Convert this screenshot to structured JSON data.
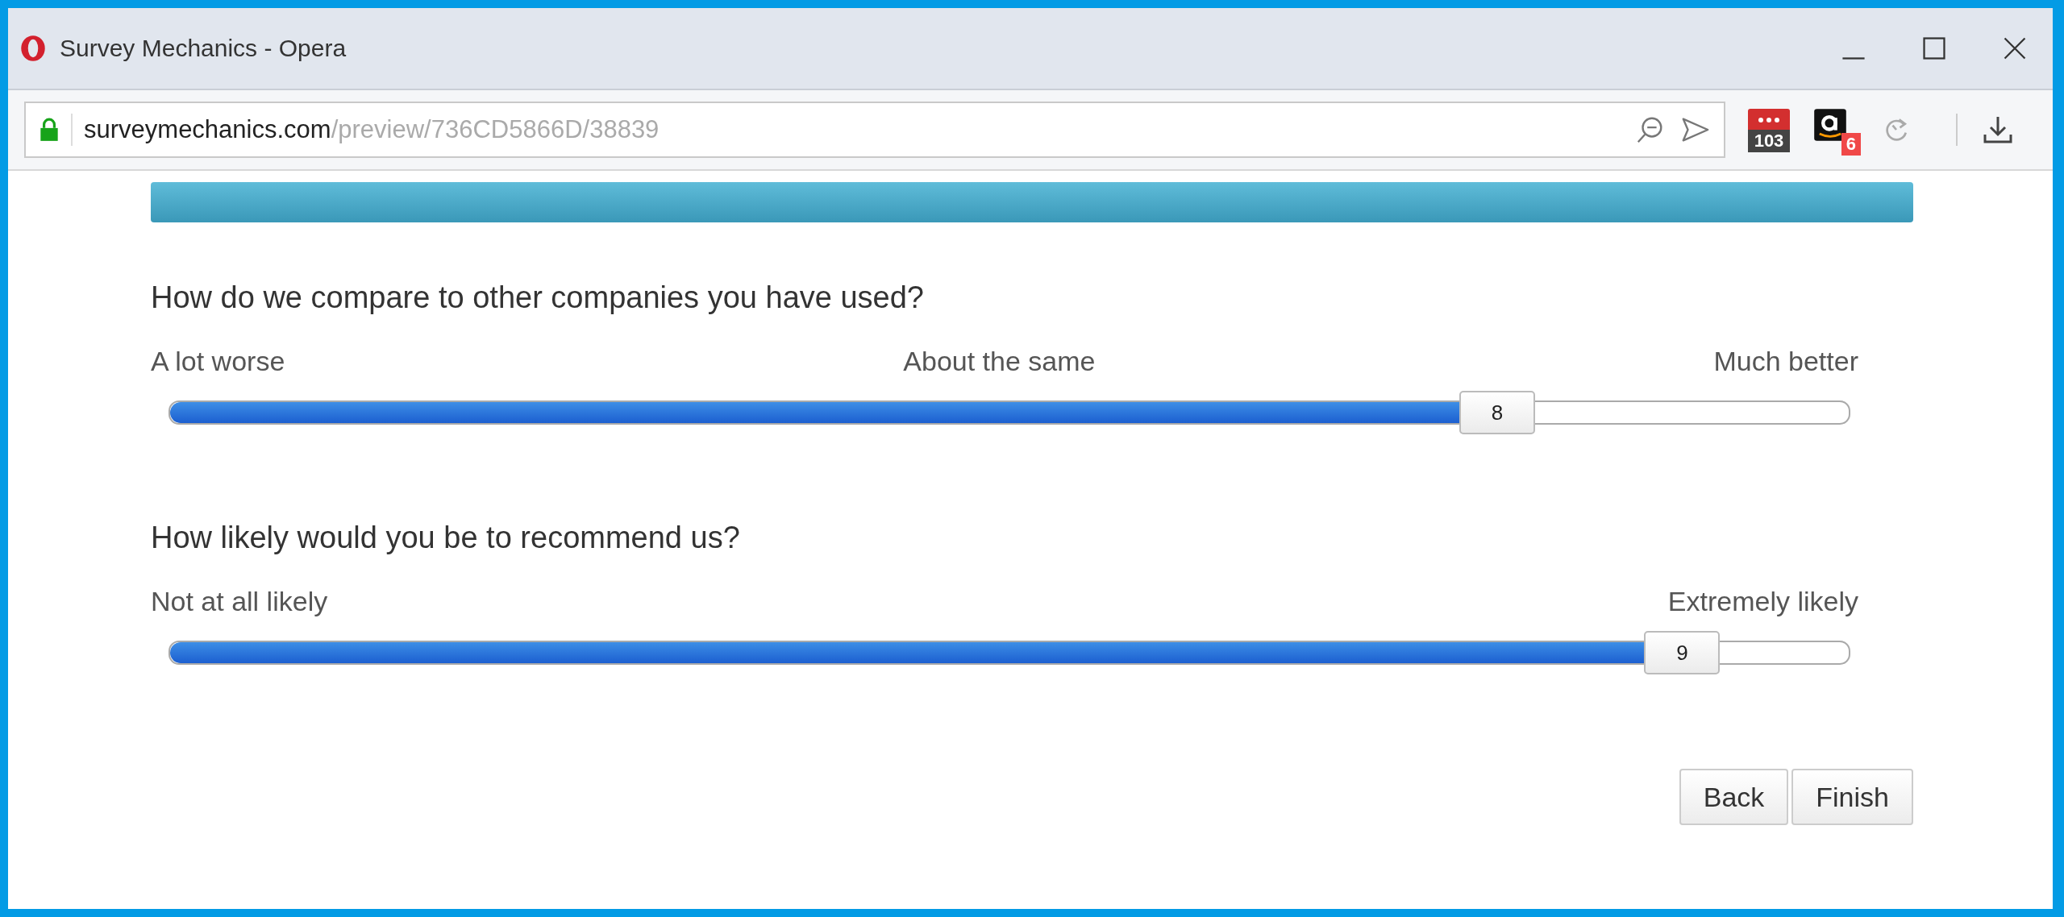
{
  "window": {
    "title": "Survey Mechanics - Opera"
  },
  "address_bar": {
    "domain": "surveymechanics.com",
    "path": "/preview/736CD5866D/38839"
  },
  "toolbar": {
    "extensions": [
      {
        "kind": "counter",
        "badge": "103"
      },
      {
        "kind": "shop",
        "badge": "6"
      },
      {
        "kind": "sync"
      }
    ]
  },
  "progress": {
    "level": 1
  },
  "questions": [
    {
      "text": "How do we compare to other companies you have used?",
      "labels": [
        "A lot worse",
        "About the same",
        "Much better"
      ],
      "level": 0.79,
      "value": "8"
    },
    {
      "text": "How likely would you be to recommend us?",
      "labels": [
        "Not at all likely",
        "Extremely likely"
      ],
      "level": 0.9,
      "value": "9"
    }
  ],
  "buttons": [
    "Back",
    "Finish"
  ]
}
